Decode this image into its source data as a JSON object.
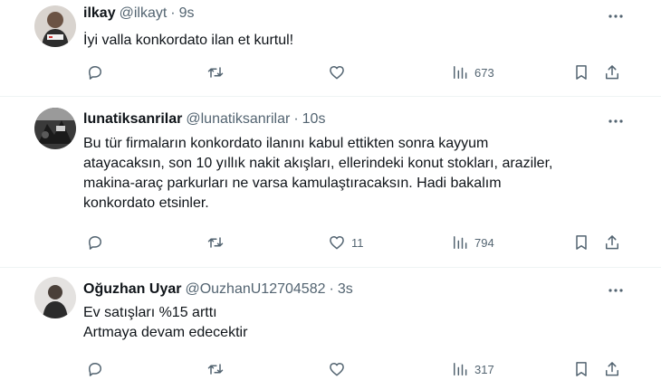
{
  "tweets": [
    {
      "name": "ilkay",
      "handle": "@ilkayt",
      "separator": "·",
      "time": "9s",
      "lines": [
        "İyi valla konkordato ilan et kurtul!"
      ],
      "views": "673",
      "likes": ""
    },
    {
      "name": "lunatiksanrilar",
      "handle": "@lunatiksanrilar",
      "separator": "·",
      "time": "10s",
      "lines": [
        "Bu tür firmaların konkordato ilanını kabul ettikten sonra kayyum",
        "atayacaksın, son 10 yıllık nakit akışları, ellerindeki konut stokları, araziler,",
        "makina-araç parkurları ne varsa kamulaştıracaksın. Hadi bakalım",
        "konkordato etsinler."
      ],
      "views": "794",
      "likes": "11"
    },
    {
      "name": "Oğuzhan Uyar",
      "handle": "@OuzhanU12704582",
      "separator": "·",
      "time": "3s",
      "lines": [
        "Ev satışları %15 arttı",
        "Artmaya devam edecektir"
      ],
      "views": "317",
      "likes": ""
    }
  ],
  "icons": {
    "reply": "reply-icon",
    "retweet": "retweet-icon",
    "like": "heart-icon",
    "views": "views-icon",
    "bookmark": "bookmark-icon",
    "share": "share-icon",
    "more": "more-icon"
  },
  "colors": {
    "text": "#0f1419",
    "secondary": "#536471",
    "divider": "#eff3f4"
  }
}
